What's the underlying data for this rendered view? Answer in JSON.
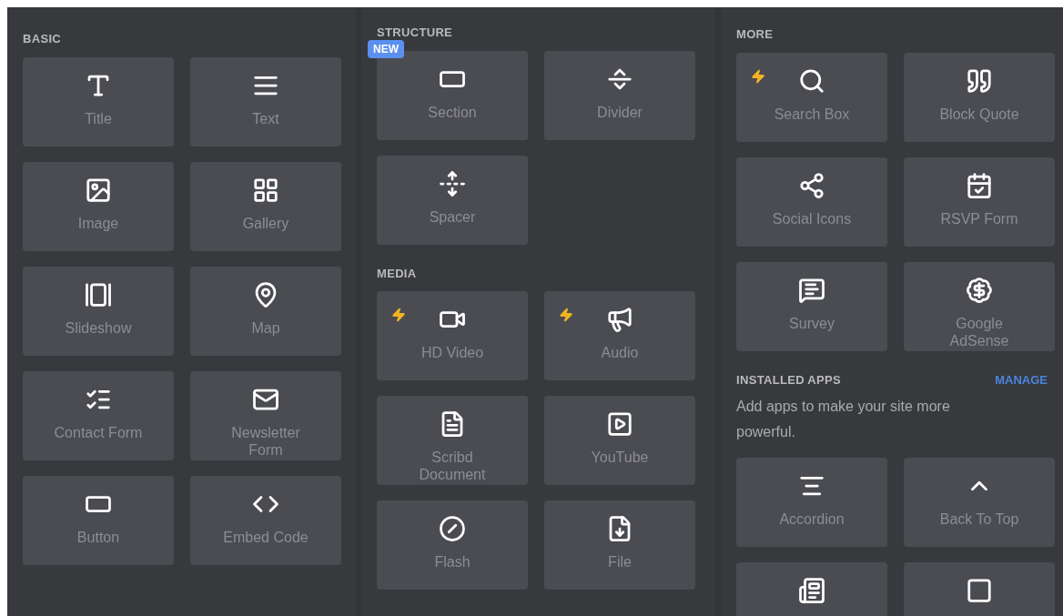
{
  "columns": [
    {
      "sections": [
        {
          "heading": "BASIC",
          "tiles": [
            {
              "label": "Title",
              "bolt": false
            },
            {
              "label": "Text",
              "bolt": false
            },
            {
              "label": "Image",
              "bolt": false
            },
            {
              "label": "Gallery",
              "bolt": false
            },
            {
              "label": "Slideshow",
              "bolt": false
            },
            {
              "label": "Map",
              "bolt": false
            },
            {
              "label": "Contact Form",
              "bolt": false
            },
            {
              "label": "Newsletter\nForm",
              "bolt": false
            },
            {
              "label": "Button",
              "bolt": false
            },
            {
              "label": "Embed Code",
              "bolt": false
            }
          ]
        }
      ]
    },
    {
      "sections": [
        {
          "heading": "STRUCTURE",
          "tiles": [
            {
              "label": "Section",
              "bolt": false,
              "badge": "NEW"
            },
            {
              "label": "Divider",
              "bolt": false
            },
            {
              "label": "Spacer",
              "bolt": false
            }
          ]
        },
        {
          "heading": "MEDIA",
          "tiles": [
            {
              "label": "HD Video",
              "bolt": true
            },
            {
              "label": "Audio",
              "bolt": true
            },
            {
              "label": "Scribd\nDocument",
              "bolt": false
            },
            {
              "label": "YouTube",
              "bolt": false
            },
            {
              "label": "Flash",
              "bolt": false
            },
            {
              "label": "File",
              "bolt": false
            }
          ]
        }
      ]
    },
    {
      "sections": [
        {
          "heading": "MORE",
          "tiles": [
            {
              "label": "Search Box",
              "bolt": true
            },
            {
              "label": "Block Quote",
              "bolt": false
            },
            {
              "label": "Social Icons",
              "bolt": false
            },
            {
              "label": "RSVP Form",
              "bolt": false
            },
            {
              "label": "Survey",
              "bolt": false
            },
            {
              "label": "Google\nAdSense",
              "bolt": false
            }
          ]
        },
        {
          "heading": "INSTALLED APPS",
          "link": "MANAGE",
          "description": "Add apps to make your site more powerful.",
          "tiles": [
            {
              "label": "Accordion",
              "bolt": false
            },
            {
              "label": "Back To Top",
              "bolt": false
            },
            {
              "bolt": false
            },
            {
              "bolt": false
            }
          ]
        }
      ]
    }
  ]
}
